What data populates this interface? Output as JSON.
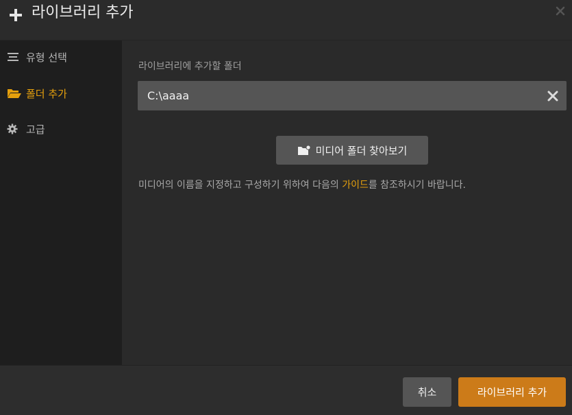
{
  "header": {
    "title": "라이브러리 추가",
    "plus_icon": "plus-icon",
    "close_icon": "close-icon"
  },
  "sidebar": {
    "items": [
      {
        "label": "유형 선택",
        "icon": "list-icon",
        "active": false
      },
      {
        "label": "폴더 추가",
        "icon": "folder-open-icon",
        "active": true
      },
      {
        "label": "고급",
        "icon": "gear-icon",
        "active": false
      }
    ]
  },
  "main": {
    "folder_label": "라이브러리에 추가할 폴더",
    "folder_value": "C:\\aaaa",
    "browse_label": "미디어 폴더 찾아보기",
    "help_prefix": "미디어의 이름을 지정하고 구성하기 위하여 다음의 ",
    "help_link": "가이드",
    "help_suffix": "를 참조하시기 바랍니다."
  },
  "footer": {
    "cancel_label": "취소",
    "confirm_label": "라이브러리 추가"
  },
  "colors": {
    "accent": "#e5a00d",
    "primary_button": "#cc7b19"
  }
}
